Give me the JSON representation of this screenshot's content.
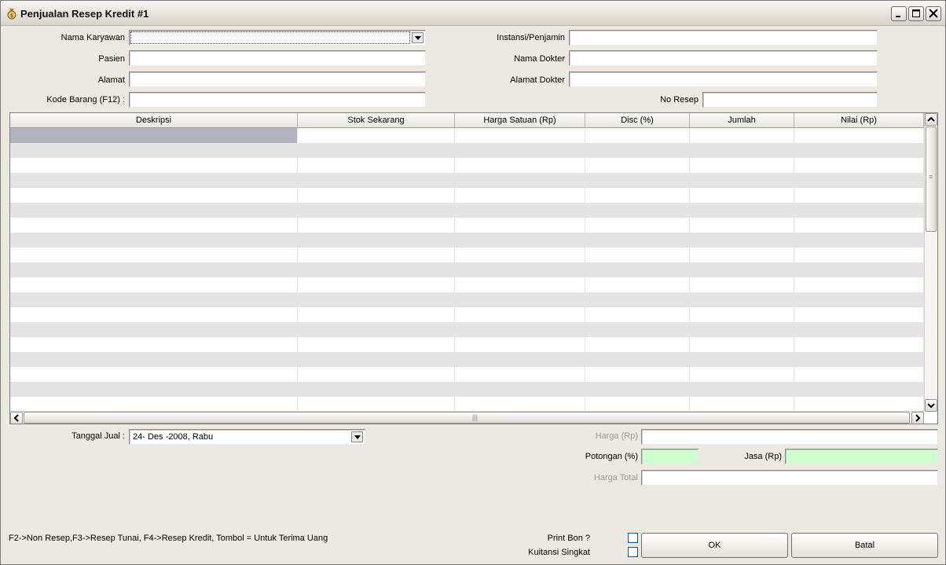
{
  "window": {
    "title": "Penjualan Resep Kredit #1"
  },
  "form": {
    "nama_karyawan": {
      "label": "Nama Karyawan",
      "value": ""
    },
    "pasien": {
      "label": "Pasien",
      "value": ""
    },
    "alamat": {
      "label": "Alamat",
      "value": ""
    },
    "kode_barang": {
      "label": "Kode Barang (F12) :",
      "value": ""
    },
    "instansi": {
      "label": "Instansi/Penjamin",
      "value": ""
    },
    "nama_dokter": {
      "label": "Nama Dokter",
      "value": ""
    },
    "alamat_dokter": {
      "label": "Alamat Dokter",
      "value": ""
    },
    "no_resep": {
      "label": "No Resep",
      "value": ""
    }
  },
  "grid": {
    "columns": [
      "Deskripsi",
      "Stok Sekarang",
      "Harga Satuan (Rp)",
      "Disc (%)",
      "Jumlah",
      "Nilai (Rp)"
    ],
    "row_count": 19
  },
  "bottom": {
    "tanggal_jual": {
      "label": "Tanggal Jual :",
      "value": "24- Des -2008,  Rabu"
    },
    "harga": {
      "label": "Harga (Rp)",
      "value": ""
    },
    "potongan": {
      "label": "Potongan (%)",
      "value": ""
    },
    "jasa": {
      "label": "Jasa (Rp)",
      "value": ""
    },
    "harga_total": {
      "label": "Harga Total",
      "value": ""
    },
    "print_bon": {
      "label": "Print Bon ?",
      "checked": false
    },
    "kuitansi": {
      "label": "Kuitansi Singkat",
      "checked": false
    },
    "ok_label": "OK",
    "batal_label": "Batal",
    "hint": "F2->Non Resep,F3->Resep Tunai, F4->Resep Kredit, Tombol = Untuk Terima Uang"
  },
  "colors": {
    "window_bg": "#ece9e2",
    "field_green": "#ccffcc",
    "grid_alt_row": "#e4e4e4",
    "grid_selected": "#b3b3bd"
  }
}
